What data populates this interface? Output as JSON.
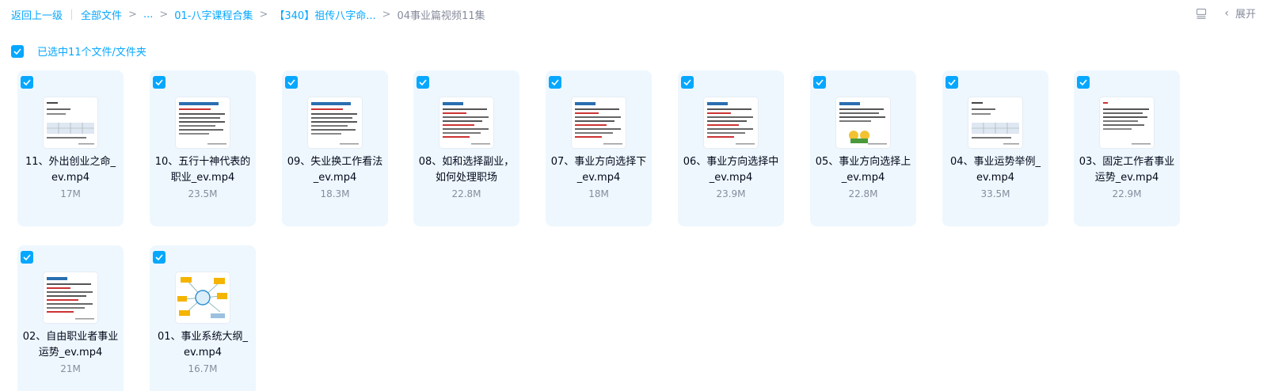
{
  "breadcrumb": {
    "back": "返回上一级",
    "items": [
      "全部文件",
      "...",
      "01-八字课程合集",
      "【340】祖传八字命...",
      "04事业篇视频11集"
    ]
  },
  "toolbar": {
    "expand_label": "展开"
  },
  "selection": {
    "text": "已选中11个文件/文件夹"
  },
  "files": [
    {
      "name": "11、外出创业之命_ev.mp4",
      "size": "17M",
      "thumb": "doc-table"
    },
    {
      "name": "10、五行十神代表的职业_ev.mp4",
      "size": "23.5M",
      "thumb": "doc-header"
    },
    {
      "name": "09、失业换工作看法_ev.mp4",
      "size": "18.3M",
      "thumb": "doc-header"
    },
    {
      "name": "08、如和选择副业，如何处理职场",
      "size": "22.8M",
      "thumb": "doc-header-red"
    },
    {
      "name": "07、事业方向选择下_ev.mp4",
      "size": "18M",
      "thumb": "doc-header-red"
    },
    {
      "name": "06、事业方向选择中_ev.mp4",
      "size": "23.9M",
      "thumb": "doc-header-red"
    },
    {
      "name": "05、事业方向选择上_ev.mp4",
      "size": "22.8M",
      "thumb": "doc-cartoon"
    },
    {
      "name": "04、事业运势举例_ev.mp4",
      "size": "33.5M",
      "thumb": "doc-table"
    },
    {
      "name": "03、固定工作者事业运势_ev.mp4",
      "size": "22.9M",
      "thumb": "doc-plain"
    },
    {
      "name": "02、自由职业者事业运势_ev.mp4",
      "size": "21M",
      "thumb": "doc-header-red"
    },
    {
      "name": "01、事业系统大纲_ev.mp4",
      "size": "16.7M",
      "thumb": "mindmap"
    }
  ],
  "colors": {
    "accent": "#06a7ff",
    "card_bg": "#eef7fe",
    "muted": "#878c9c"
  }
}
